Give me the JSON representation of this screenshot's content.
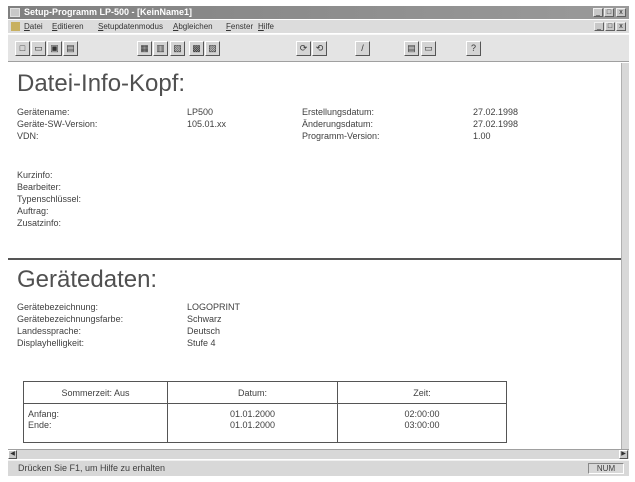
{
  "window": {
    "title": "Setup-Programm LP-500 - [KeinName1]",
    "controls": [
      "_",
      "□",
      "x"
    ]
  },
  "menu": [
    "Datei",
    "Editieren",
    "Setupdatenmodus",
    "Abgleichen",
    "Fenster",
    "Hilfe"
  ],
  "toolbar_icons": [
    "new-file-icon",
    "open-icon",
    "save-icon",
    "print-icon",
    "page-icon",
    "page-icon",
    "page-icon",
    "page-icon",
    "page-icon",
    "arrow-icon",
    "arrow-icon",
    "pen-icon",
    "screen-icon",
    "screen-icon",
    "help-icon"
  ],
  "info": {
    "heading": "Datei-Info-Kopf:",
    "left": [
      {
        "label": "Gerätename:",
        "value": "LP500"
      },
      {
        "label": "Geräte-SW-Version:",
        "value": "105.01.xx"
      },
      {
        "label": "VDN:",
        "value": ""
      }
    ],
    "right": [
      {
        "label": "Erstellungsdatum:",
        "value": "27.02.1998"
      },
      {
        "label": "Änderungsdatum:",
        "value": "27.02.1998"
      },
      {
        "label": "Programm-Version:",
        "value": "1.00"
      }
    ],
    "extra": [
      "Kurzinfo:",
      "Bearbeiter:",
      "Typenschlüssel:",
      "Auftrag:",
      "Zusatzinfo:"
    ]
  },
  "device": {
    "heading": "Gerätedaten:",
    "rows": [
      {
        "label": "Gerätebezeichnung:",
        "value": "LOGOPRINT"
      },
      {
        "label": "Gerätebezeichnungsfarbe:",
        "value": "Schwarz"
      },
      {
        "label": "Landessprache:",
        "value": "Deutsch"
      },
      {
        "label": "Displayhelligkeit:",
        "value": "Stufe 4"
      }
    ]
  },
  "dst_table": {
    "headers": [
      "Sommerzeit: Aus",
      "Datum:",
      "Zeit:"
    ],
    "rows": [
      {
        "label": "Anfang:",
        "date": "01.01.2000",
        "time": "02:00:00"
      },
      {
        "label": "Ende:",
        "date": "01.01.2000",
        "time": "03:00:00"
      }
    ]
  },
  "status": {
    "text": "Drücken Sie F1, um Hilfe zu erhalten",
    "num": "NUM"
  }
}
